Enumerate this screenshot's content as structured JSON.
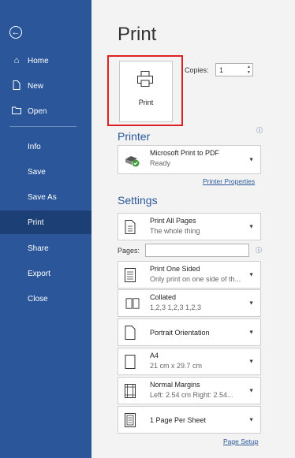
{
  "sidebar": {
    "back_glyph": "←",
    "items": [
      {
        "label": "Home",
        "icon": "home-icon"
      },
      {
        "label": "New",
        "icon": "new-document-icon"
      },
      {
        "label": "Open",
        "icon": "open-folder-icon"
      },
      {
        "label": "Info"
      },
      {
        "label": "Save"
      },
      {
        "label": "Save As"
      },
      {
        "label": "Print",
        "active": true
      },
      {
        "label": "Share"
      },
      {
        "label": "Export"
      },
      {
        "label": "Close"
      }
    ]
  },
  "print": {
    "title": "Print",
    "button_label": "Print",
    "copies_label": "Copies:",
    "copies_value": "1"
  },
  "printer": {
    "heading": "Printer",
    "name": "Microsoft Print to PDF",
    "status": "Ready",
    "properties_link": "Printer Properties"
  },
  "settings": {
    "heading": "Settings",
    "pages_label": "Pages:",
    "options": [
      {
        "line1": "Print All Pages",
        "line2": "The whole thing",
        "icon": "page-range-icon"
      },
      {
        "line1": "Print One Sided",
        "line2": "Only print on one side of th...",
        "icon": "one-sided-icon"
      },
      {
        "line1": "Collated",
        "line2": "1,2,3   1,2,3   1,2,3",
        "icon": "collated-icon"
      },
      {
        "line1": "Portrait Orientation",
        "line2": "",
        "icon": "portrait-icon"
      },
      {
        "line1": "A4",
        "line2": "21 cm x 29.7 cm",
        "icon": "paper-size-icon"
      },
      {
        "line1": "Normal Margins",
        "line2": "Left:  2.54 cm   Right:  2.54...",
        "icon": "margins-icon"
      },
      {
        "line1": "1 Page Per Sheet",
        "line2": "",
        "icon": "pages-per-sheet-icon"
      }
    ],
    "page_setup_link": "Page Setup"
  },
  "colors": {
    "accent": "#2b579a",
    "highlight": "#e02020",
    "background": "#f3f3f3"
  }
}
